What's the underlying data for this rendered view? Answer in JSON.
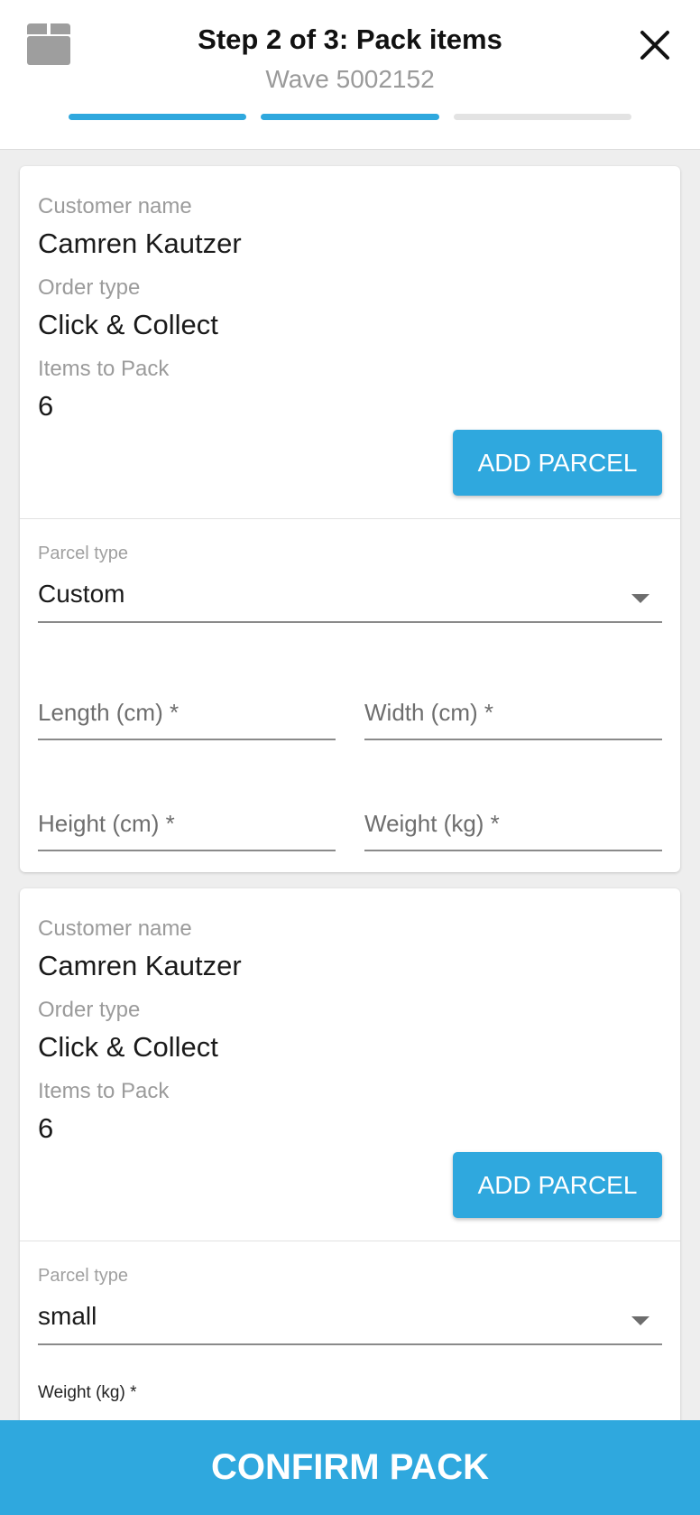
{
  "header": {
    "title": "Step 2 of 3: Pack items",
    "subtitle": "Wave 5002152",
    "box_icon": "box-icon",
    "close_icon": "close-icon",
    "progress": {
      "total_steps": 3,
      "completed_steps": 2
    }
  },
  "orders": [
    {
      "customer_label": "Customer name",
      "customer_name": "Camren Kautzer",
      "order_type_label": "Order type",
      "order_type": "Click & Collect",
      "items_label": "Items to Pack",
      "items_count": "6",
      "add_parcel_label": "ADD PARCEL",
      "parcel_type_label": "Parcel type",
      "parcel_type_value": "Custom",
      "fields": {
        "length": "Length (cm) *",
        "width": "Width (cm) *",
        "height": "Height (cm) *",
        "weight": "Weight (kg) *"
      }
    },
    {
      "customer_label": "Customer name",
      "customer_name": "Camren Kautzer",
      "order_type_label": "Order type",
      "order_type": "Click & Collect",
      "items_label": "Items to Pack",
      "items_count": "6",
      "add_parcel_label": "ADD PARCEL",
      "parcel_type_label": "Parcel type",
      "parcel_type_value": "small",
      "weight_label": "Weight (kg) *"
    }
  ],
  "footer": {
    "confirm_label": "CONFIRM PACK"
  },
  "colors": {
    "accent": "#2fa8de",
    "muted_text": "#9b9b9b",
    "track": "#e3e3e3"
  }
}
